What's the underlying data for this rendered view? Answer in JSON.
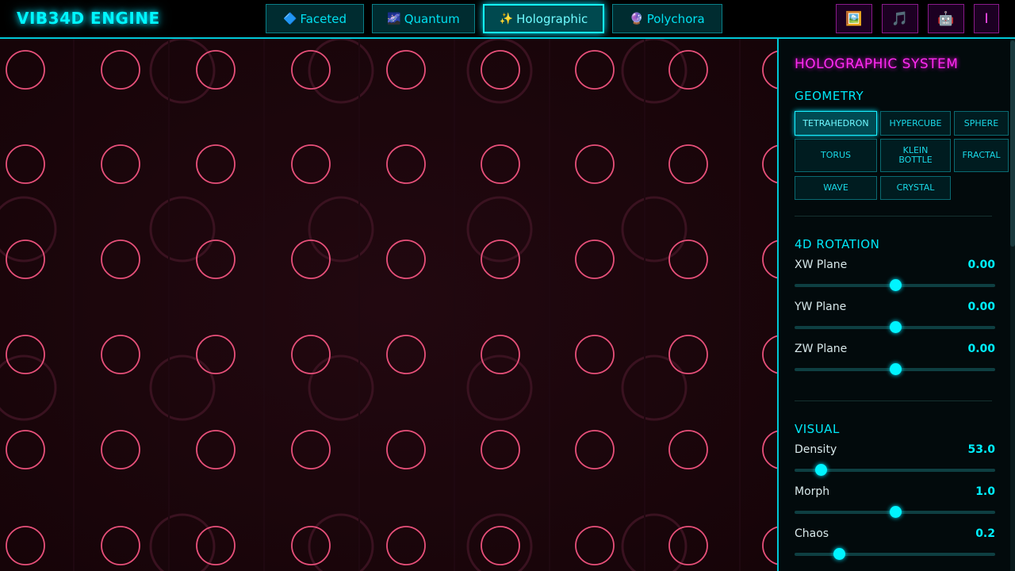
{
  "app": {
    "title": "VIB34D ENGINE"
  },
  "tabs": [
    {
      "icon": "🔷",
      "label": "Faceted",
      "active": false
    },
    {
      "icon": "🌌",
      "label": "Quantum",
      "active": false
    },
    {
      "icon": "✨",
      "label": "Holographic",
      "active": true
    },
    {
      "icon": "🔮",
      "label": "Polychora",
      "active": false
    }
  ],
  "header_buttons": [
    {
      "icon": "🖼️",
      "name": "gallery-icon"
    },
    {
      "icon": "🎵",
      "name": "music-icon"
    },
    {
      "icon": "🤖",
      "name": "robot-icon"
    },
    {
      "icon": "I",
      "name": "info-icon"
    }
  ],
  "panel": {
    "title": "HOLOGRAPHIC SYSTEM",
    "geometry": {
      "title": "GEOMETRY",
      "options": [
        "TETRAHEDRON",
        "HYPERCUBE",
        "SPHERE",
        "TORUS",
        "KLEIN BOTTLE",
        "FRACTAL",
        "WAVE",
        "CRYSTAL"
      ],
      "selected": "TETRAHEDRON"
    },
    "rotation": {
      "title": "4D ROTATION",
      "sliders": [
        {
          "label": "XW Plane",
          "value": "0.00",
          "fraction": 0.5
        },
        {
          "label": "YW Plane",
          "value": "0.00",
          "fraction": 0.5
        },
        {
          "label": "ZW Plane",
          "value": "0.00",
          "fraction": 0.5
        }
      ]
    },
    "visual": {
      "title": "VISUAL",
      "sliders": [
        {
          "label": "Density",
          "value": "53.0",
          "fraction": 0.13
        },
        {
          "label": "Morph",
          "value": "1.0",
          "fraction": 0.5
        },
        {
          "label": "Chaos",
          "value": "0.2",
          "fraction": 0.22
        }
      ]
    }
  },
  "colors": {
    "accent": "#00f0ff",
    "magenta": "#ff2bf2",
    "ring": "#e8507a",
    "bg": "#160408"
  }
}
